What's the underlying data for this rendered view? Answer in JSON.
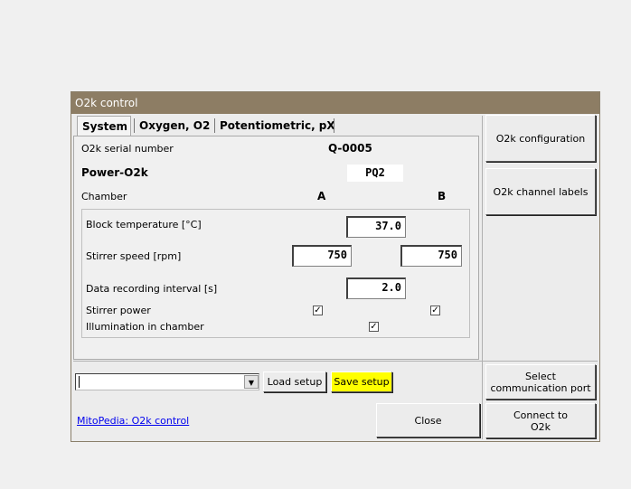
{
  "window": {
    "title": "O2k control"
  },
  "tabs": [
    {
      "label": "System"
    },
    {
      "label": "Oxygen, O2"
    },
    {
      "label": "Potentiometric, pX"
    }
  ],
  "system": {
    "serial_label": "O2k serial number",
    "serial_value": "Q-0005",
    "power_label": "Power-O2k",
    "power_value": "PQ2",
    "chamber_label": "Chamber",
    "chamber_a": "A",
    "chamber_b": "B",
    "block_temp_label": "Block temperature [°C]",
    "block_temp_value": "37.0",
    "stirrer_speed_label": "Stirrer speed [rpm]",
    "stirrer_speed_a": "750",
    "stirrer_speed_b": "750",
    "interval_label": "Data recording interval [s]",
    "interval_value": "2.0",
    "stirrer_power_label": "Stirrer power",
    "stirrer_power_a_checked": true,
    "stirrer_power_b_checked": true,
    "illumination_label": "Illumination in chamber",
    "illumination_checked": true
  },
  "buttons": {
    "o2k_configuration": "O2k configuration",
    "channel_labels": "O2k channel labels",
    "load_setup": "Load setup",
    "save_setup": "Save setup",
    "select_port_line1": "Select",
    "select_port_line2": "communication port",
    "close": "Close",
    "connect_line1": "Connect to",
    "connect_line2": "O2k"
  },
  "setup_combo": {
    "value": ""
  },
  "link": {
    "label": "MitoPedia: O2k control"
  },
  "colors": {
    "titlebar": "#8d7d64",
    "save_button": "#ffff00",
    "link": "#0000ee"
  },
  "icons": {
    "checkbox": "check-mark",
    "combo": "triangle-down"
  }
}
